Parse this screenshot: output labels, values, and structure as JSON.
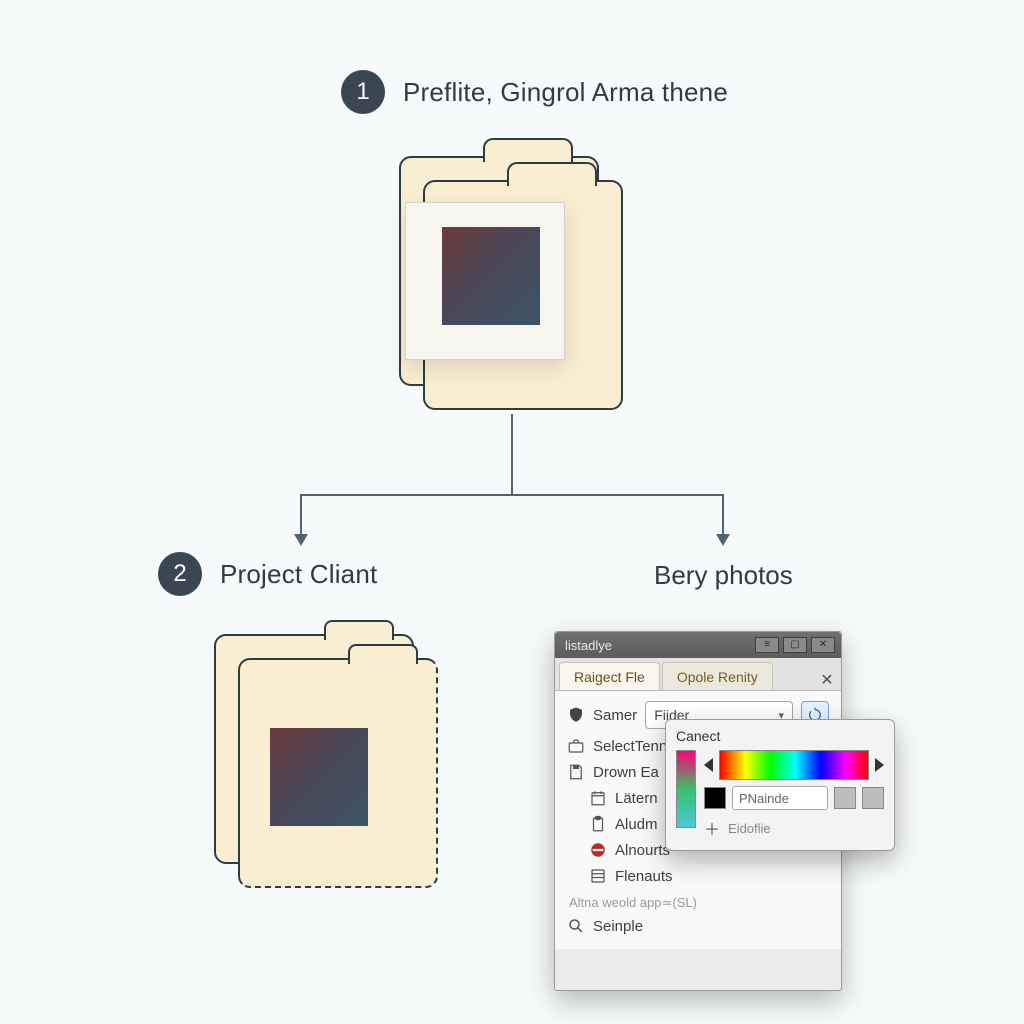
{
  "step1": {
    "number": "1",
    "title": "Preflite, Gingrol Arma thene"
  },
  "step2": {
    "number": "2",
    "title": "Project Cliant"
  },
  "node3": {
    "title": "Bery photos"
  },
  "panel": {
    "window_title": "listadlye",
    "tabs": {
      "active": "Raigect Fle",
      "inactive": "Opole Renity"
    },
    "field_label": "Samer",
    "select_value": "Fiider",
    "list": {
      "item1": "SelectTenn",
      "item2": "Drown Ea",
      "item3": "Lätern",
      "item4": "Aludm",
      "item5": "Alnourts",
      "item6": "Flenauts"
    },
    "hint": "Altna weold app≃(SL)",
    "search": "Seinple"
  },
  "color_picker": {
    "title": "Canect",
    "input_value": "PNainde",
    "add_label": "Eidoflie"
  }
}
